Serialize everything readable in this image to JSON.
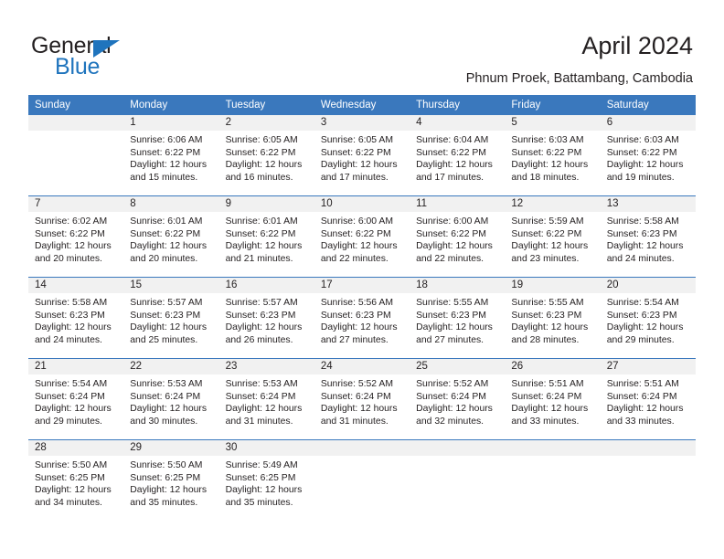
{
  "brand": {
    "name_top": "General",
    "name_bottom": "Blue",
    "accent_color": "#1f74bd"
  },
  "header": {
    "title": "April 2024",
    "subtitle": "Phnum Proek, Battambang, Cambodia"
  },
  "theme": {
    "header_bar_color": "#3a78bd",
    "day_band_color": "#f1f1f1",
    "text_color": "#231f20"
  },
  "weekdays": [
    "Sunday",
    "Monday",
    "Tuesday",
    "Wednesday",
    "Thursday",
    "Friday",
    "Saturday"
  ],
  "weeks": [
    [
      {
        "day": "",
        "lines": []
      },
      {
        "day": "1",
        "lines": [
          "Sunrise: 6:06 AM",
          "Sunset: 6:22 PM",
          "Daylight: 12 hours",
          "and 15 minutes."
        ]
      },
      {
        "day": "2",
        "lines": [
          "Sunrise: 6:05 AM",
          "Sunset: 6:22 PM",
          "Daylight: 12 hours",
          "and 16 minutes."
        ]
      },
      {
        "day": "3",
        "lines": [
          "Sunrise: 6:05 AM",
          "Sunset: 6:22 PM",
          "Daylight: 12 hours",
          "and 17 minutes."
        ]
      },
      {
        "day": "4",
        "lines": [
          "Sunrise: 6:04 AM",
          "Sunset: 6:22 PM",
          "Daylight: 12 hours",
          "and 17 minutes."
        ]
      },
      {
        "day": "5",
        "lines": [
          "Sunrise: 6:03 AM",
          "Sunset: 6:22 PM",
          "Daylight: 12 hours",
          "and 18 minutes."
        ]
      },
      {
        "day": "6",
        "lines": [
          "Sunrise: 6:03 AM",
          "Sunset: 6:22 PM",
          "Daylight: 12 hours",
          "and 19 minutes."
        ]
      }
    ],
    [
      {
        "day": "7",
        "lines": [
          "Sunrise: 6:02 AM",
          "Sunset: 6:22 PM",
          "Daylight: 12 hours",
          "and 20 minutes."
        ]
      },
      {
        "day": "8",
        "lines": [
          "Sunrise: 6:01 AM",
          "Sunset: 6:22 PM",
          "Daylight: 12 hours",
          "and 20 minutes."
        ]
      },
      {
        "day": "9",
        "lines": [
          "Sunrise: 6:01 AM",
          "Sunset: 6:22 PM",
          "Daylight: 12 hours",
          "and 21 minutes."
        ]
      },
      {
        "day": "10",
        "lines": [
          "Sunrise: 6:00 AM",
          "Sunset: 6:22 PM",
          "Daylight: 12 hours",
          "and 22 minutes."
        ]
      },
      {
        "day": "11",
        "lines": [
          "Sunrise: 6:00 AM",
          "Sunset: 6:22 PM",
          "Daylight: 12 hours",
          "and 22 minutes."
        ]
      },
      {
        "day": "12",
        "lines": [
          "Sunrise: 5:59 AM",
          "Sunset: 6:22 PM",
          "Daylight: 12 hours",
          "and 23 minutes."
        ]
      },
      {
        "day": "13",
        "lines": [
          "Sunrise: 5:58 AM",
          "Sunset: 6:23 PM",
          "Daylight: 12 hours",
          "and 24 minutes."
        ]
      }
    ],
    [
      {
        "day": "14",
        "lines": [
          "Sunrise: 5:58 AM",
          "Sunset: 6:23 PM",
          "Daylight: 12 hours",
          "and 24 minutes."
        ]
      },
      {
        "day": "15",
        "lines": [
          "Sunrise: 5:57 AM",
          "Sunset: 6:23 PM",
          "Daylight: 12 hours",
          "and 25 minutes."
        ]
      },
      {
        "day": "16",
        "lines": [
          "Sunrise: 5:57 AM",
          "Sunset: 6:23 PM",
          "Daylight: 12 hours",
          "and 26 minutes."
        ]
      },
      {
        "day": "17",
        "lines": [
          "Sunrise: 5:56 AM",
          "Sunset: 6:23 PM",
          "Daylight: 12 hours",
          "and 27 minutes."
        ]
      },
      {
        "day": "18",
        "lines": [
          "Sunrise: 5:55 AM",
          "Sunset: 6:23 PM",
          "Daylight: 12 hours",
          "and 27 minutes."
        ]
      },
      {
        "day": "19",
        "lines": [
          "Sunrise: 5:55 AM",
          "Sunset: 6:23 PM",
          "Daylight: 12 hours",
          "and 28 minutes."
        ]
      },
      {
        "day": "20",
        "lines": [
          "Sunrise: 5:54 AM",
          "Sunset: 6:23 PM",
          "Daylight: 12 hours",
          "and 29 minutes."
        ]
      }
    ],
    [
      {
        "day": "21",
        "lines": [
          "Sunrise: 5:54 AM",
          "Sunset: 6:24 PM",
          "Daylight: 12 hours",
          "and 29 minutes."
        ]
      },
      {
        "day": "22",
        "lines": [
          "Sunrise: 5:53 AM",
          "Sunset: 6:24 PM",
          "Daylight: 12 hours",
          "and 30 minutes."
        ]
      },
      {
        "day": "23",
        "lines": [
          "Sunrise: 5:53 AM",
          "Sunset: 6:24 PM",
          "Daylight: 12 hours",
          "and 31 minutes."
        ]
      },
      {
        "day": "24",
        "lines": [
          "Sunrise: 5:52 AM",
          "Sunset: 6:24 PM",
          "Daylight: 12 hours",
          "and 31 minutes."
        ]
      },
      {
        "day": "25",
        "lines": [
          "Sunrise: 5:52 AM",
          "Sunset: 6:24 PM",
          "Daylight: 12 hours",
          "and 32 minutes."
        ]
      },
      {
        "day": "26",
        "lines": [
          "Sunrise: 5:51 AM",
          "Sunset: 6:24 PM",
          "Daylight: 12 hours",
          "and 33 minutes."
        ]
      },
      {
        "day": "27",
        "lines": [
          "Sunrise: 5:51 AM",
          "Sunset: 6:24 PM",
          "Daylight: 12 hours",
          "and 33 minutes."
        ]
      }
    ],
    [
      {
        "day": "28",
        "lines": [
          "Sunrise: 5:50 AM",
          "Sunset: 6:25 PM",
          "Daylight: 12 hours",
          "and 34 minutes."
        ]
      },
      {
        "day": "29",
        "lines": [
          "Sunrise: 5:50 AM",
          "Sunset: 6:25 PM",
          "Daylight: 12 hours",
          "and 35 minutes."
        ]
      },
      {
        "day": "30",
        "lines": [
          "Sunrise: 5:49 AM",
          "Sunset: 6:25 PM",
          "Daylight: 12 hours",
          "and 35 minutes."
        ]
      },
      {
        "day": "",
        "lines": []
      },
      {
        "day": "",
        "lines": []
      },
      {
        "day": "",
        "lines": []
      },
      {
        "day": "",
        "lines": []
      }
    ]
  ]
}
